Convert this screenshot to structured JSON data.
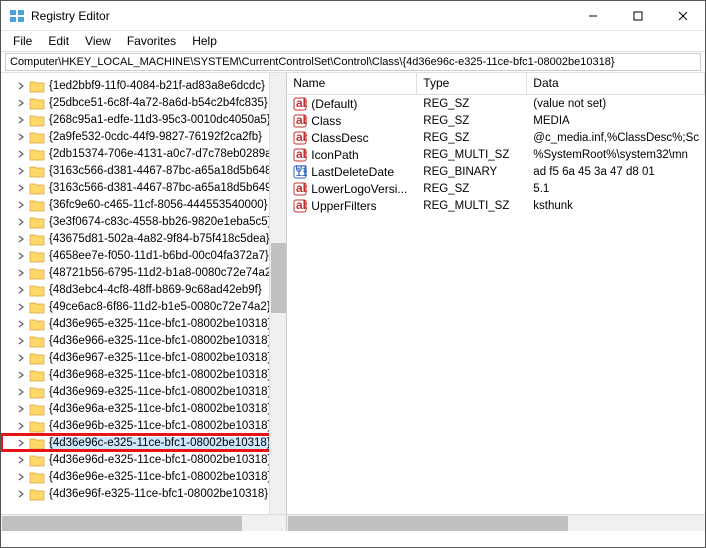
{
  "window": {
    "title": "Registry Editor"
  },
  "menu": {
    "file": "File",
    "edit": "Edit",
    "view": "View",
    "favorites": "Favorites",
    "help": "Help"
  },
  "address": "Computer\\HKEY_LOCAL_MACHINE\\SYSTEM\\CurrentControlSet\\Control\\Class\\{4d36e96c-e325-11ce-bfc1-08002be10318}",
  "tree": [
    "{1ed2bbf9-11f0-4084-b21f-ad83a8e6dcdc}",
    "{25dbce51-6c8f-4a72-8a6d-b54c2b4fc835}",
    "{268c95a1-edfe-11d3-95c3-0010dc4050a5}",
    "{2a9fe532-0cdc-44f9-9827-76192f2ca2fb}",
    "{2db15374-706e-4131-a0c7-d7c78eb0289a}",
    "{3163c566-d381-4467-87bc-a65a18d5b648}",
    "{3163c566-d381-4467-87bc-a65a18d5b649}",
    "{36fc9e60-c465-11cf-8056-444553540000}",
    "{3e3f0674-c83c-4558-bb26-9820e1eba5c5}",
    "{43675d81-502a-4a82-9f84-b75f418c5dea}",
    "{4658ee7e-f050-11d1-b6bd-00c04fa372a7}",
    "{48721b56-6795-11d2-b1a8-0080c72e74a2}",
    "{48d3ebc4-4cf8-48ff-b869-9c68ad42eb9f}",
    "{49ce6ac8-6f86-11d2-b1e5-0080c72e74a2}",
    "{4d36e965-e325-11ce-bfc1-08002be10318}",
    "{4d36e966-e325-11ce-bfc1-08002be10318}",
    "{4d36e967-e325-11ce-bfc1-08002be10318}",
    "{4d36e968-e325-11ce-bfc1-08002be10318}",
    "{4d36e969-e325-11ce-bfc1-08002be10318}",
    "{4d36e96a-e325-11ce-bfc1-08002be10318}",
    "{4d36e96b-e325-11ce-bfc1-08002be10318}",
    "{4d36e96c-e325-11ce-bfc1-08002be10318}",
    "{4d36e96d-e325-11ce-bfc1-08002be10318}",
    "{4d36e96e-e325-11ce-bfc1-08002be10318}",
    "{4d36e96f-e325-11ce-bfc1-08002be10318}"
  ],
  "selected_index": 21,
  "columns": {
    "name": "Name",
    "type": "Type",
    "data": "Data"
  },
  "values": [
    {
      "icon": "str",
      "name": "(Default)",
      "type": "REG_SZ",
      "data": "(value not set)"
    },
    {
      "icon": "str",
      "name": "Class",
      "type": "REG_SZ",
      "data": "MEDIA"
    },
    {
      "icon": "str",
      "name": "ClassDesc",
      "type": "REG_SZ",
      "data": "@c_media.inf,%ClassDesc%;Sc"
    },
    {
      "icon": "str",
      "name": "IconPath",
      "type": "REG_MULTI_SZ",
      "data": "%SystemRoot%\\system32\\mn"
    },
    {
      "icon": "bin",
      "name": "LastDeleteDate",
      "type": "REG_BINARY",
      "data": "ad f5 6a 45 3a 47 d8 01"
    },
    {
      "icon": "str",
      "name": "LowerLogoVersi...",
      "type": "REG_SZ",
      "data": "5.1"
    },
    {
      "icon": "str",
      "name": "UpperFilters",
      "type": "REG_MULTI_SZ",
      "data": "ksthunk"
    }
  ]
}
